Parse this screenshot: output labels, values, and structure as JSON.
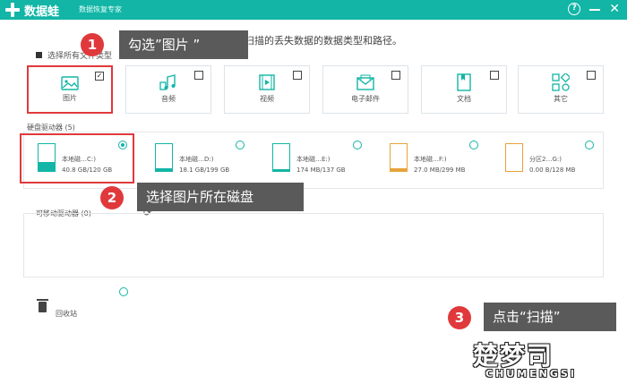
{
  "app": {
    "brand": "数据蛙",
    "subtitle": "数据恢复专家"
  },
  "prompt": "选择要扫描的丢失数据的数据类型和路径。",
  "select_all_label": "选择所有文件类型",
  "file_types": [
    {
      "label": "图片",
      "icon": "image-icon",
      "checked": true
    },
    {
      "label": "音频",
      "icon": "audio-icon",
      "checked": false
    },
    {
      "label": "视频",
      "icon": "video-icon",
      "checked": false
    },
    {
      "label": "电子邮件",
      "icon": "email-icon",
      "checked": false
    },
    {
      "label": "文档",
      "icon": "document-icon",
      "checked": false
    },
    {
      "label": "其它",
      "icon": "other-icon",
      "checked": false
    }
  ],
  "hard_drives_label": "硬盘驱动器 (5)",
  "drives": [
    {
      "name": "本地磁…C:)",
      "size": "40.8 GB/120 GB",
      "fill": 0.34,
      "color": "#12b5a6",
      "selected": true
    },
    {
      "name": "本地磁…D:)",
      "size": "18.1 GB/199 GB",
      "fill": 0.09,
      "color": "#12b5a6",
      "selected": false
    },
    {
      "name": "本地磁…E:)",
      "size": "174 MB/137 GB",
      "fill": 0.01,
      "color": "#12b5a6",
      "selected": false
    },
    {
      "name": "本地磁…F:)",
      "size": "27.0 MB/299 MB",
      "fill": 0.09,
      "color": "#e8a23a",
      "selected": false
    },
    {
      "name": "分区2…G:)",
      "size": "0.00 B/128 MB",
      "fill": 0.0,
      "color": "#e8a23a",
      "selected": false
    }
  ],
  "removable_label": "可移动驱动器 (0)",
  "recycle_bin_label": "回收站",
  "callouts": [
    {
      "num": "1",
      "text": "勾选”图片 ”"
    },
    {
      "num": "2",
      "text": "选择图片所在磁盘"
    },
    {
      "num": "3",
      "text": "点击“扫描”"
    }
  ],
  "watermark": {
    "main": "楚梦司",
    "sub": "CHUMENGSI"
  },
  "colors": {
    "accent": "#12b5a6",
    "highlight": "#e0393c",
    "callout_bg": "#5a5a5a"
  }
}
